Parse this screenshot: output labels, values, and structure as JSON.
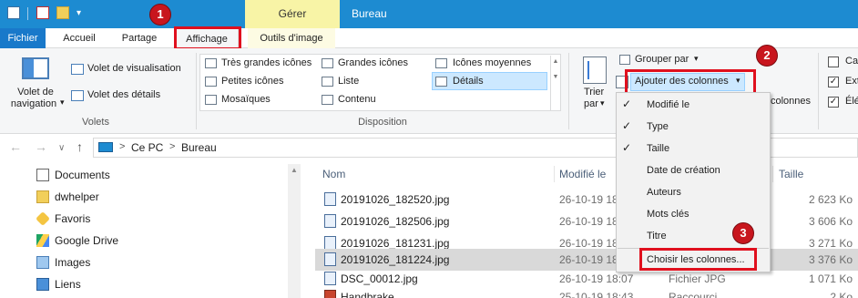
{
  "titlebar": {
    "context_tab": "Gérer",
    "window_title": "Bureau",
    "colors": {
      "titlebar": "#1d8bd1",
      "context_tab": "#f8f4a6",
      "highlight_red": "#e0101e"
    }
  },
  "tabs": {
    "fichier": "Fichier",
    "accueil": "Accueil",
    "partage": "Partage",
    "affichage": "Affichage",
    "outils": "Outils d'image"
  },
  "badges": {
    "one": "1",
    "two": "2",
    "three": "3"
  },
  "ribbon": {
    "volets": {
      "nav_pane_line1": "Volet de",
      "nav_pane_line2": "navigation",
      "preview_pane": "Volet de visualisation",
      "details_pane": "Volet des détails",
      "group_label": "Volets"
    },
    "disposition": {
      "items": [
        "Très grandes icônes",
        "Grandes icônes",
        "Icônes moyennes",
        "Petites icônes",
        "Liste",
        "Détails",
        "Mosaïques",
        "Contenu"
      ],
      "group_label": "Disposition"
    },
    "affichage_actuel": {
      "sort_line1": "Trier",
      "sort_line2": "par",
      "group_by": "Grouper par",
      "add_columns": "Ajouter des colonnes",
      "size_columns_partial": "colonnes"
    },
    "show_hide": {
      "item1_partial": "Ca",
      "item2_partial": "Ext",
      "item3_partial": "Élé"
    }
  },
  "address": {
    "crumbs": [
      "Ce PC",
      "Bureau"
    ]
  },
  "nav_pane": {
    "items": [
      "Documents",
      "dwhelper",
      "Favoris",
      "Google Drive",
      "Images",
      "Liens"
    ]
  },
  "file_list": {
    "columns": {
      "name": "Nom",
      "modified": "Modifié le",
      "size": "Taille"
    },
    "rows": [
      {
        "name": "20191026_182520.jpg",
        "modified": "26-10-19 18",
        "type": "",
        "size": "2 623 Ko"
      },
      {
        "name": "20191026_182506.jpg",
        "modified": "26-10-19 18",
        "type": "",
        "size": "3 606 Ko"
      },
      {
        "name": "20191026_181231.jpg",
        "modified": "26-10-19 18",
        "type": "",
        "size": "3 271 Ko"
      },
      {
        "name": "20191026_181224.jpg",
        "modified": "26-10-19 18",
        "type": "",
        "size": "3 376 Ko"
      },
      {
        "name": "DSC_00012.jpg",
        "modified": "26-10-19 18:07",
        "type": "Fichier JPG",
        "size": "1 071 Ko"
      },
      {
        "name": "Handbrake",
        "modified": "25-10-19 18:43",
        "type": "Raccourci",
        "size": "2 Ko"
      }
    ]
  },
  "menu": {
    "items": [
      {
        "label": "Modifié le",
        "checked": "✓"
      },
      {
        "label": "Type",
        "checked": "✓"
      },
      {
        "label": "Taille",
        "checked": "✓"
      },
      {
        "label": "Date de création",
        "checked": ""
      },
      {
        "label": "Auteurs",
        "checked": ""
      },
      {
        "label": "Mots clés",
        "checked": ""
      },
      {
        "label": "Titre",
        "checked": ""
      },
      {
        "label": "Choisir les colonnes...",
        "checked": ""
      }
    ]
  },
  "icons": {
    "back": "←",
    "forward": "→",
    "dropdown": "∨",
    "up": "↑",
    "chevron": ">",
    "caret": "▾",
    "scroll_up": "▲",
    "scroll_down": "▼"
  }
}
